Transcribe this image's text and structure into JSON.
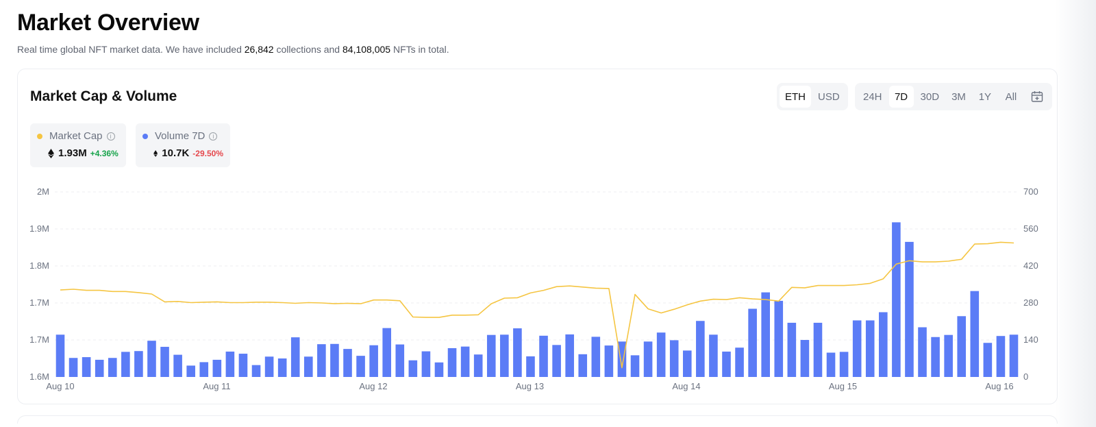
{
  "header": {
    "title": "Market Overview",
    "sub_pre": "Real time global NFT market data. We have included ",
    "collections": "26,842",
    "sub_mid": " collections and ",
    "nfts": "84,108,005",
    "sub_post": " NFTs in total."
  },
  "card": {
    "title": "Market Cap & Volume",
    "currency_options": [
      "ETH",
      "USD"
    ],
    "currency_selected": "ETH",
    "range_options": [
      "24H",
      "7D",
      "30D",
      "3M",
      "1Y",
      "All"
    ],
    "range_selected": "7D",
    "calendar_icon": "calendar-icon"
  },
  "legend": {
    "market_cap": {
      "label": "Market Cap",
      "value": "1.93M",
      "change": "+4.36%",
      "color": "#f5c542"
    },
    "volume": {
      "label": "Volume 7D",
      "value": "10.7K",
      "change": "-29.50%",
      "color": "#5b7cf6"
    }
  },
  "chart_data": {
    "type": "bar+line",
    "x_labels": [
      "Aug 10",
      "Aug 11",
      "Aug 12",
      "Aug 13",
      "Aug 14",
      "Aug 15",
      "Aug 16"
    ],
    "left_axis_ticks": [
      "2M",
      "1.9M",
      "1.8M",
      "1.7M",
      "1.7M",
      "1.6M"
    ],
    "left_range": [
      1.6,
      2.1
    ],
    "right_axis_ticks": [
      "700",
      "560",
      "420",
      "280",
      "140",
      "0"
    ],
    "right_range": [
      0,
      700
    ],
    "grid": true,
    "series": [
      {
        "name": "Volume 7D",
        "kind": "bar",
        "axis": "right",
        "color": "#5b7cf6",
        "values": [
          160,
          72,
          75,
          65,
          72,
          95,
          98,
          137,
          114,
          84,
          43,
          56,
          65,
          96,
          88,
          45,
          77,
          70,
          150,
          77,
          124,
          125,
          106,
          80,
          120,
          185,
          123,
          63,
          97,
          55,
          109,
          115,
          85,
          159,
          160,
          184,
          78,
          156,
          121,
          161,
          86,
          152,
          119,
          134,
          82,
          134,
          168,
          139,
          100,
          212,
          160,
          96,
          111,
          258,
          320,
          288,
          205,
          140,
          205,
          92,
          95,
          214,
          214,
          245,
          585,
          511,
          188,
          151,
          159,
          230,
          325,
          129,
          155,
          160
        ]
      },
      {
        "name": "Market Cap",
        "kind": "line",
        "axis": "left",
        "color": "#f5c542",
        "values": [
          1.835,
          1.837,
          1.834,
          1.834,
          1.831,
          1.831,
          1.828,
          1.824,
          1.803,
          1.804,
          1.801,
          1.802,
          1.803,
          1.801,
          1.801,
          1.802,
          1.802,
          1.801,
          1.799,
          1.801,
          1.8,
          1.798,
          1.799,
          1.798,
          1.808,
          1.808,
          1.806,
          1.762,
          1.761,
          1.761,
          1.767,
          1.767,
          1.768,
          1.798,
          1.813,
          1.814,
          1.827,
          1.834,
          1.844,
          1.846,
          1.843,
          1.84,
          1.839,
          1.625,
          1.823,
          1.784,
          1.773,
          1.783,
          1.795,
          1.805,
          1.81,
          1.809,
          1.814,
          1.811,
          1.809,
          1.805,
          1.842,
          1.841,
          1.847,
          1.847,
          1.847,
          1.849,
          1.853,
          1.865,
          1.905,
          1.914,
          1.911,
          1.911,
          1.913,
          1.918,
          1.959,
          1.96,
          1.964,
          1.962
        ]
      }
    ]
  }
}
